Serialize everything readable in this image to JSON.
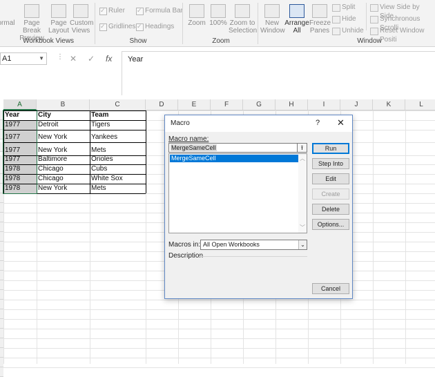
{
  "ribbon": {
    "workbook_views": {
      "label": "Workbook Views",
      "buttons": [
        {
          "line1": "ormal",
          "line2": ""
        },
        {
          "line1": "Page Break",
          "line2": "Preview"
        },
        {
          "line1": "Page",
          "line2": "Layout"
        },
        {
          "line1": "Custom",
          "line2": "Views"
        }
      ]
    },
    "show": {
      "label": "Show",
      "ruler": "Ruler",
      "formula_bar": "Formula Bar",
      "gridlines": "Gridlines",
      "headings": "Headings"
    },
    "zoom": {
      "label": "Zoom",
      "zoom": "Zoom",
      "hundred": "100%",
      "selection_line1": "Zoom to",
      "selection_line2": "Selection"
    },
    "window": {
      "label": "Window",
      "new_line1": "New",
      "new_line2": "Window",
      "arrange_line1": "Arrange",
      "arrange_line2": "All",
      "freeze_line1": "Freeze",
      "freeze_line2": "Panes",
      "split": "Split",
      "hide": "Hide",
      "unhide": "Unhide",
      "side_by_side": "View Side by Side",
      "sync_scroll": "Synchronous Scrolli",
      "reset_position": "Reset Window Positi"
    }
  },
  "formula_bar": {
    "name_box": "A1",
    "cancel": "✕",
    "enter": "✓",
    "fx": "fx",
    "value": "Year"
  },
  "sheet": {
    "columns": [
      "A",
      "B",
      "C",
      "D",
      "E",
      "F",
      "G",
      "H",
      "I",
      "J",
      "K",
      "L"
    ],
    "headers": [
      "Year",
      "City",
      "Team"
    ],
    "rows": [
      [
        "1977",
        "Detroit",
        "Tigers"
      ],
      [
        "1977",
        "New York",
        "Yankees"
      ],
      [
        "1977",
        "New York",
        "Mets"
      ],
      [
        "1977",
        "Baltimore",
        "Orioles"
      ],
      [
        "1978",
        "Chicago",
        "Cubs"
      ],
      [
        "1978",
        "Chicago",
        "White Sox"
      ],
      [
        "1978",
        "New York",
        "Mets"
      ]
    ]
  },
  "dialog": {
    "title": "Macro",
    "help": "?",
    "close": "✕",
    "macro_name_label": "Macro name:",
    "macro_name_value": "MergeSameCell",
    "macro_list": [
      "MergeSameCell"
    ],
    "buttons": {
      "run": "Run",
      "step_into": "Step Into",
      "edit": "Edit",
      "create": "Create",
      "delete": "Delete",
      "options": "Options...",
      "cancel": "Cancel"
    },
    "macros_in_label": "Macros in:",
    "macros_in_value": "All Open Workbooks",
    "description_label": "Description"
  }
}
